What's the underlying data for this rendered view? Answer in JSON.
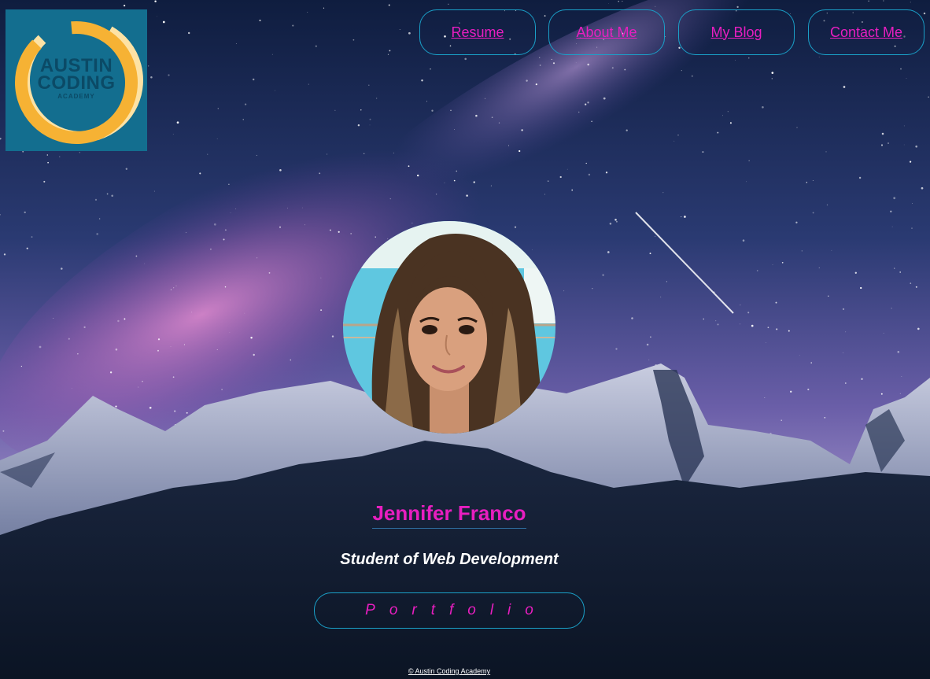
{
  "logo": {
    "line1": "AUSTIN",
    "line2": "CODING",
    "line3": "ACADEMY",
    "colors": {
      "background": "#136e8f",
      "ring": "#f6b234",
      "ring_light": "#fde2a4",
      "text": "#0b4a66"
    }
  },
  "nav": {
    "items": [
      {
        "label": "Resume"
      },
      {
        "label": "About Me"
      },
      {
        "label": "My Blog"
      },
      {
        "label": "Contact Me"
      }
    ]
  },
  "hero": {
    "avatar_icon": "profile-photo",
    "name": "Jennifer Franco",
    "tagline": "Student of Web Development",
    "portfolio_label": "Portfolio"
  },
  "footer": {
    "text": "© Austin Coding Academy"
  },
  "colors": {
    "accent": "#e81ec0",
    "border": "#1aa0c8",
    "text_light": "#ffffff"
  }
}
